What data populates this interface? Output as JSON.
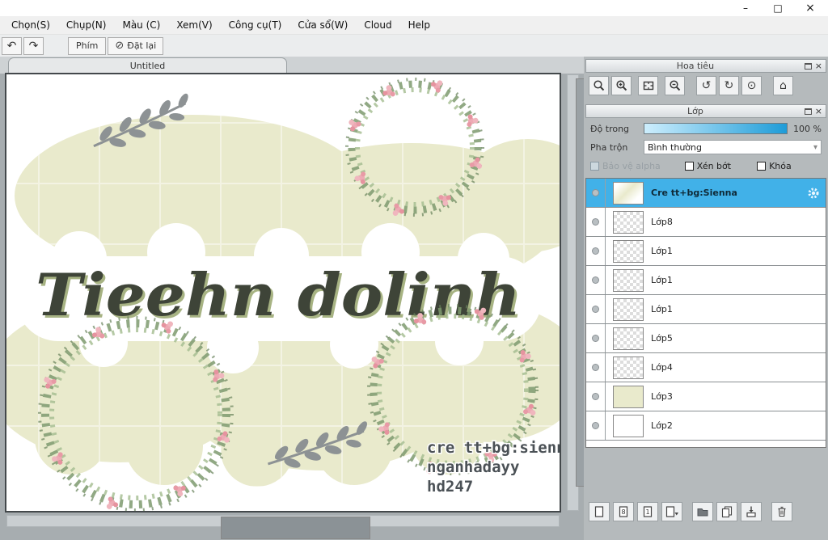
{
  "window": {
    "minimize": "–",
    "maximize": "□",
    "close": "×"
  },
  "menubar": {
    "items": [
      {
        "label": "Chọn(S)"
      },
      {
        "label": "Chụp(N)"
      },
      {
        "label": "Màu (C)"
      },
      {
        "label": "Xem(V)"
      },
      {
        "label": "Công cụ(T)"
      },
      {
        "label": "Cửa sổ(W)"
      },
      {
        "label": "Cloud"
      },
      {
        "label": "Help"
      }
    ]
  },
  "toolbar": {
    "key_button": "Phím",
    "reset_button": "Đặt lại"
  },
  "icons": {
    "undo": "↶",
    "redo": "↷",
    "reset": "⊘",
    "rotate_left": "↺",
    "rotate_right": "↻",
    "reset_rotation": "⊙",
    "reset_view": "⌂",
    "dropdown_arrow": "▾",
    "eight": "8",
    "one": "1"
  },
  "tabbar": {
    "active_tab": "Untitled"
  },
  "canvas": {
    "lettering": "Tieehn dolinh",
    "credits": [
      "cre tt+bg:sienna",
      "nganhadayy",
      "hd247"
    ]
  },
  "navigator": {
    "title": "Hoa tiêu"
  },
  "layers": {
    "title": "Lớp",
    "opacity_label": "Độ trong",
    "opacity_value": "100 %",
    "blend_label": "Pha trộn",
    "blend_mode": "Bình thường",
    "protect_alpha_label": "Bảo vệ alpha",
    "clipping_label": "Xén bớt",
    "lock_label": "Khóa",
    "items": [
      {
        "name": "Cre tt+bg:Sienna"
      },
      {
        "name": "Lớp8"
      },
      {
        "name": "Lớp1"
      },
      {
        "name": "Lớp1"
      },
      {
        "name": "Lớp1"
      },
      {
        "name": "Lớp5"
      },
      {
        "name": "Lớp4"
      },
      {
        "name": "Lớp3"
      },
      {
        "name": "Lớp2"
      }
    ]
  }
}
